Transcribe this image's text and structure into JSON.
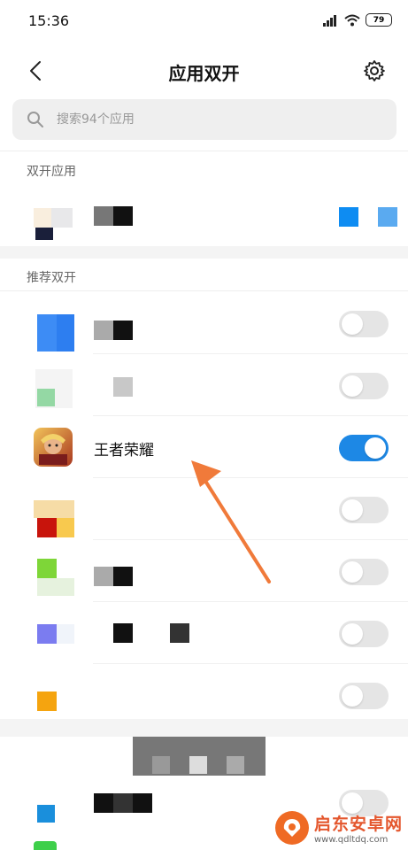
{
  "status_bar": {
    "time": "15:36",
    "battery": "79"
  },
  "header": {
    "title": "应用双开"
  },
  "search": {
    "placeholder": "搜索94个应用"
  },
  "sections": {
    "dual_apps": "双开应用",
    "recommended": "推荐双开"
  },
  "apps": {
    "featured": {
      "name": "王者荣耀",
      "toggle_on": true
    }
  },
  "colors": {
    "accent": "#1d88e5",
    "arrow": "#f07a3a",
    "toggle_off": "#e5e5e5"
  },
  "icons": [
    "back-arrow-icon",
    "gear-icon",
    "search-icon",
    "wifi-icon",
    "signal-icon"
  ],
  "watermark": {
    "title": "启东安卓网",
    "url": "www.qdltdq.com"
  }
}
